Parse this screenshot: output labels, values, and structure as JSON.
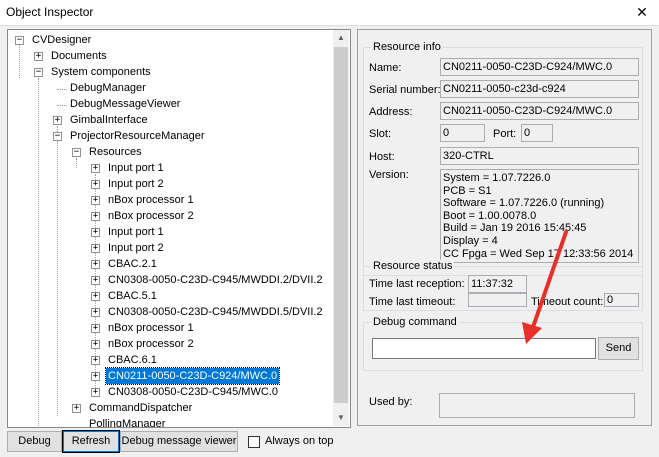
{
  "window": {
    "title": "Object Inspector",
    "close_glyph": "✕"
  },
  "tree": {
    "items": [
      {
        "label": "CVDesigner",
        "expander": "−"
      },
      {
        "label": "Documents",
        "expander": "+"
      },
      {
        "label": "System components",
        "expander": "−"
      },
      {
        "label": "DebugManager",
        "expander": ""
      },
      {
        "label": "DebugMessageViewer",
        "expander": ""
      },
      {
        "label": "GimbalInterface",
        "expander": "+"
      },
      {
        "label": "ProjectorResourceManager",
        "expander": "−"
      },
      {
        "label": "Resources",
        "expander": "−"
      },
      {
        "label": "Input port 1",
        "expander": "+"
      },
      {
        "label": "Input port 2",
        "expander": "+"
      },
      {
        "label": "nBox processor 1",
        "expander": "+"
      },
      {
        "label": "nBox processor 2",
        "expander": "+"
      },
      {
        "label": "Input port 1",
        "expander": "+"
      },
      {
        "label": "Input port 2",
        "expander": "+"
      },
      {
        "label": "CBAC.2.1",
        "expander": "+"
      },
      {
        "label": "CN0308-0050-C23D-C945/MWDDI.2/DVII.2",
        "expander": "+"
      },
      {
        "label": "CBAC.5.1",
        "expander": "+"
      },
      {
        "label": "CN0308-0050-C23D-C945/MWDDI.5/DVII.2",
        "expander": "+"
      },
      {
        "label": "nBox processor 1",
        "expander": "+"
      },
      {
        "label": "nBox processor 2",
        "expander": "+"
      },
      {
        "label": "CBAC.6.1",
        "expander": "+"
      },
      {
        "label": "CN0211-0050-C23D-C924/MWC.0",
        "expander": "+",
        "selected": true
      },
      {
        "label": "CN0308-0050-C23D-C945/MWC.0",
        "expander": "+"
      },
      {
        "label": "CommandDispatcher",
        "expander": "+"
      },
      {
        "label": "PollingManager",
        "expander": ""
      }
    ]
  },
  "resource_info": {
    "title": "Resource info",
    "name_label": "Name:",
    "name_value": "CN0211-0050-C23D-C924/MWC.0",
    "serial_label": "Serial number:",
    "serial_value": "CN0211-0050-c23d-c924",
    "address_label": "Address:",
    "address_value": "CN0211-0050-C23D-C924/MWC.0",
    "slot_label": "Slot:",
    "slot_value": "0",
    "port_label": "Port:",
    "port_value": "0",
    "host_label": "Host:",
    "host_value": "320-CTRL",
    "version_label": "Version:",
    "version_lines": [
      "System = 1.07.7226.0",
      "PCB = S1",
      "Software = 1.07.7226.0  (running)",
      "Boot = 1.00.0078.0",
      "Build = Jan 19 2016 15:45:45",
      "Display = 4",
      "CC Fpga = Wed Sep 17 12:33:56 2014"
    ]
  },
  "resource_status": {
    "title": "Resource status",
    "last_reception_label": "Time last reception:",
    "last_reception_value": "11:37:32",
    "last_timeout_label": "Time last timeout:",
    "last_timeout_value": "",
    "timeout_count_label": "Timeout count:",
    "timeout_count_value": "0"
  },
  "debug_command": {
    "title": "Debug command",
    "input_value": "",
    "send_label": "Send"
  },
  "used_by": {
    "label": "Used by:",
    "value": ""
  },
  "bottom": {
    "debug_label": "Debug",
    "refresh_label": "Refresh",
    "viewer_label": "Debug message viewer",
    "always_on_top_label": "Always on top",
    "always_on_top_checked": false
  },
  "annotation": {
    "arrow_color": "#e8302a"
  },
  "icons": {
    "tree_expander": "plus-minus-box-icon",
    "scroll_up": "chevron-up-icon",
    "scroll_down": "chevron-down-icon"
  }
}
